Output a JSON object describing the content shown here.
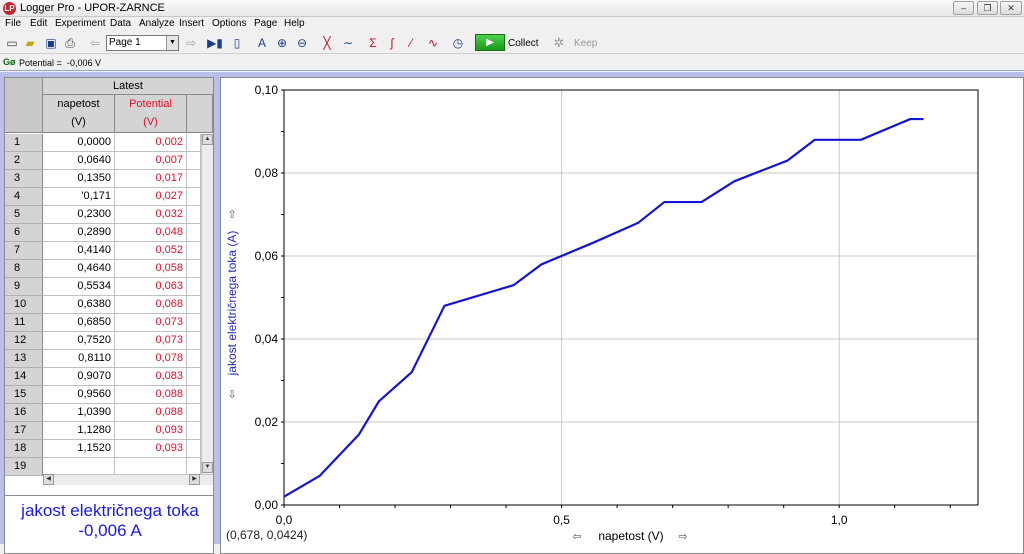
{
  "window": {
    "title": "Logger Pro - UPOR-ZARNCE",
    "minimize": "–",
    "maximize": "❐",
    "close": "✕"
  },
  "menu": [
    "File",
    "Edit",
    "Experiment",
    "Data",
    "Analyze",
    "Insert",
    "Options",
    "Page",
    "Help"
  ],
  "toolbar": {
    "page_value": "Page 1",
    "collect_label": "Collect",
    "keep_label": "Keep",
    "icons": [
      "new-file-icon",
      "open-folder-icon",
      "save-icon",
      "print-icon",
      "page-back-icon",
      "page-forward-icon",
      "data-browser-icon",
      "lab-interface-icon",
      "autoscale-icon",
      "zoom-in-icon",
      "zoom-out-icon",
      "examine-icon",
      "tangent-icon",
      "statistics-icon",
      "integral-icon",
      "linear-fit-icon",
      "curve-fit-icon",
      "timer-icon",
      "collect-icon",
      "keep-icon"
    ]
  },
  "meter_bar": {
    "label": "Potential =",
    "value": "-0,006 V"
  },
  "table": {
    "group_header": "Latest",
    "columns": [
      {
        "name": "napetost",
        "unit": "(V)",
        "color": "#000000"
      },
      {
        "name": "Potential",
        "unit": "(V)",
        "color": "#e0102a"
      }
    ],
    "rows": [
      {
        "n": "1",
        "a": "0,0000",
        "b": "0,002"
      },
      {
        "n": "2",
        "a": "0,0640",
        "b": "0,007"
      },
      {
        "n": "3",
        "a": "0,1350",
        "b": "0,017"
      },
      {
        "n": "4",
        "a": "'0,171",
        "b": "0,027"
      },
      {
        "n": "5",
        "a": "0,2300",
        "b": "0,032"
      },
      {
        "n": "6",
        "a": "0,2890",
        "b": "0,048"
      },
      {
        "n": "7",
        "a": "0,4140",
        "b": "0,052"
      },
      {
        "n": "8",
        "a": "0,4640",
        "b": "0,058"
      },
      {
        "n": "9",
        "a": "0,5534",
        "b": "0,063"
      },
      {
        "n": "10",
        "a": "0,6380",
        "b": "0,068"
      },
      {
        "n": "11",
        "a": "0,6850",
        "b": "0,073"
      },
      {
        "n": "12",
        "a": "0,7520",
        "b": "0,073"
      },
      {
        "n": "13",
        "a": "0,8110",
        "b": "0,078"
      },
      {
        "n": "14",
        "a": "0,9070",
        "b": "0,083"
      },
      {
        "n": "15",
        "a": "0,9560",
        "b": "0,088"
      },
      {
        "n": "16",
        "a": "1,0390",
        "b": "0,088"
      },
      {
        "n": "17",
        "a": "1,1280",
        "b": "0,093"
      },
      {
        "n": "18",
        "a": "1,1520",
        "b": "0,093"
      },
      {
        "n": "19",
        "a": "",
        "b": ""
      }
    ]
  },
  "meter_box": {
    "label": "jakost električnega toka",
    "value": "-0,006 A"
  },
  "graph": {
    "coord_readout": "(0,678, 0,0424)",
    "line_color": "#1414d2"
  },
  "chart_data": {
    "type": "line",
    "xlabel": "napetost (V)",
    "ylabel": "jakost električnega toka (A)",
    "xlim": [
      0,
      1.25
    ],
    "ylim": [
      0,
      0.1
    ],
    "x_ticks": [
      "0,0",
      "0,5",
      "1,0"
    ],
    "y_ticks": [
      "0,00",
      "0,02",
      "0,04",
      "0,06",
      "0,08",
      "0,10"
    ],
    "grid": true,
    "series": [
      {
        "x": [
          0.0,
          0.064,
          0.135,
          0.171,
          0.23,
          0.289,
          0.414,
          0.464,
          0.5534,
          0.638,
          0.685,
          0.752,
          0.811,
          0.907,
          0.956,
          1.039,
          1.128,
          1.152
        ],
        "y": [
          0.002,
          0.007,
          0.017,
          0.025,
          0.032,
          0.048,
          0.053,
          0.058,
          0.063,
          0.068,
          0.073,
          0.073,
          0.078,
          0.083,
          0.088,
          0.088,
          0.093,
          0.093
        ]
      }
    ]
  }
}
